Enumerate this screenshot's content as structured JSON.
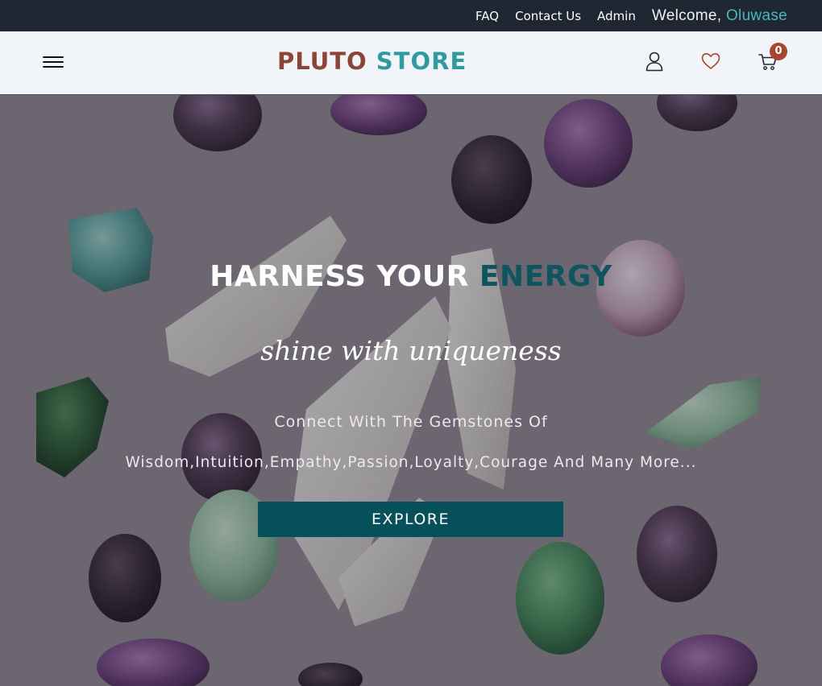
{
  "topbar": {
    "links": [
      "FAQ",
      "Contact Us",
      "Admin"
    ],
    "welcome_label": "Welcome,",
    "user_name": "Oluwase"
  },
  "header": {
    "brand_part1": "PLUTO",
    "brand_part2": "STORE",
    "cart_count": "0",
    "icons": [
      "hamburger-menu-icon",
      "user-icon",
      "heart-icon",
      "cart-icon"
    ]
  },
  "hero": {
    "title_part1": "HARNESS YOUR",
    "title_part2": "ENERGY",
    "script": "shine with uniqueness",
    "line1": "Connect With The Gemstones Of",
    "line2": "Wisdom,Intuition,Empathy,Passion,Loyalty,Courage And Many More...",
    "button": "EXPLORE"
  },
  "colors": {
    "topbar_bg": "#1f2733",
    "header_bg": "#f1f4f8",
    "brand_primary": "#8b4538",
    "brand_secondary": "#2f9aa0",
    "accent_teal": "#05505a",
    "badge": "#a8452f"
  }
}
